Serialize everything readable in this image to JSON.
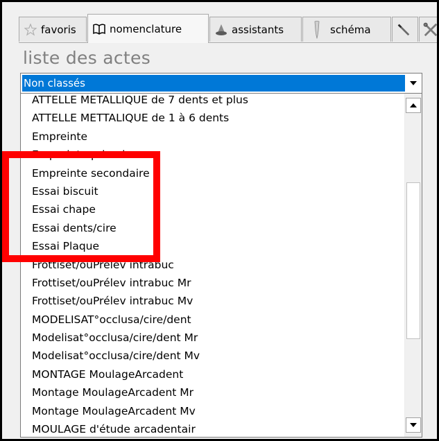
{
  "tabs": [
    {
      "id": "favoris",
      "label": "favoris",
      "icon": "star-icon"
    },
    {
      "id": "nomenclature",
      "label": "nomenclature",
      "icon": "book-icon",
      "active": true
    },
    {
      "id": "assistants",
      "label": "assistants",
      "icon": "wizard-icon"
    },
    {
      "id": "schema",
      "label": "schéma",
      "icon": "tooth-icon"
    },
    {
      "id": "tool",
      "label": "",
      "icon": "pencil-icon"
    },
    {
      "id": "tools2",
      "label": "",
      "icon": "tools-icon"
    }
  ],
  "section_title": "liste des actes",
  "category_select": {
    "selected": "Non classés"
  },
  "acts": [
    "ATTELLE METALLIQUE de 7 dents et plus",
    "ATTELLE METTALIQUE de 1 à 6 dents",
    "Empreinte",
    "Empreinte primaire",
    "Empreinte secondaire",
    "Essai biscuit",
    "Essai chape",
    "Essai dents/cire",
    "Essai Plaque",
    "Frottiset/ouPrélev intrabuc",
    "Frottiset/ouPrélev intrabuc Mr",
    "Frottiset/ouPrélev intrabuc Mv",
    "MODELISAT°occlusa/cire/dent",
    "Modelisat°occlusa/cire/dent Mr",
    "Modelisat°occlusa/cire/dent Mv",
    "MONTAGE MoulageArcadent",
    "Montage MoulageArcadent Mr",
    "Montage MoulageArcadent Mv",
    "MOULAGE d'étude arcadentair"
  ],
  "colors": {
    "accent": "#0078d7",
    "highlight": "#ff0000"
  }
}
